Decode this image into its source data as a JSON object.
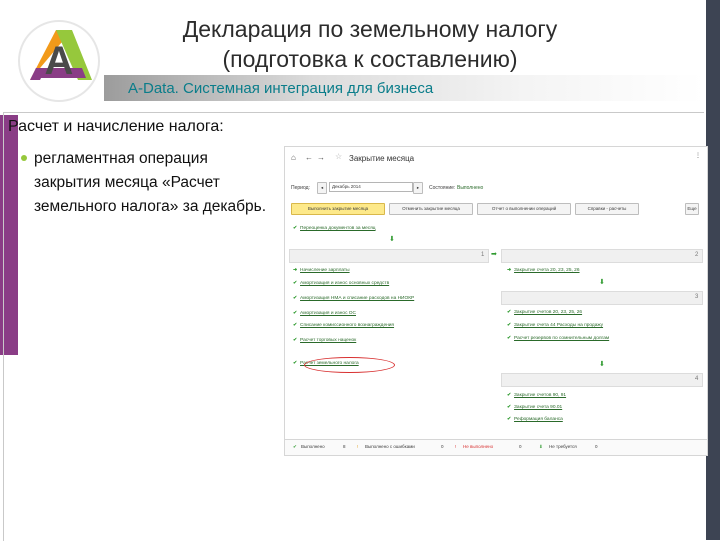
{
  "slide": {
    "title_line1": "Декларация по земельному налогу",
    "title_line2": "(подготовка к составлению)",
    "subtitle": "A-Data. Системная интеграция для бизнеса",
    "section_title": "Расчет и начисление налога:",
    "bullet_text": "регламентная операция закрытия месяца «Расчет земельного налога» за декабрь.",
    "logo_letter": "A",
    "colors": {
      "purple": "#8a3d86",
      "green": "#96c83c",
      "orange": "#f29a1a",
      "teal": "#0a7d8a",
      "dark": "#3d4453"
    }
  },
  "screenshot": {
    "window_title": "Закрытие месяца",
    "period_label": "Период:",
    "period_value": "Декабрь 2014",
    "status_label": "Состояние:",
    "status_value": "Выполнено",
    "toolbar": {
      "primary": "Выполнить закрытие месяца",
      "cancel": "Отменить закрытие месяца",
      "report": "Отчет о выполнении операций",
      "help": "Справки - расчеты",
      "more": "Еще"
    },
    "top_operation": "Переоценка документов за месяц",
    "stages": {
      "s1": "1",
      "s2": "2",
      "s3": "3",
      "s4": "4"
    },
    "left_ops": [
      "Начисление зарплаты",
      "Амортизация и износ основных средств",
      "Амортизация НМА и списание расходов на НИОКР",
      "Амортизация и износ ОС",
      "Списание комиссионного вознаграждения",
      "Расчет торговых наценок",
      "Расчет земельного налога"
    ],
    "right_top_op": "Закрытие счета 20, 23, 25, 26",
    "right_mid_ops": [
      "Закрытие счетов 20, 23, 25, 26",
      "Закрытие счета 44 Расходы на продажу",
      "Расчет резервов по сомнительным долгам"
    ],
    "right_bottom_ops": [
      "Закрытие счетов 90, 91",
      "Закрытие счета 90.01",
      "Реформация баланса"
    ],
    "footer": {
      "done": "Выполнено",
      "done_count": "8",
      "errors": "Выполнено с ошибками",
      "errors_count": "0",
      "not_done": "Не выполнено",
      "not_done_count": "0",
      "later": "Не требуется",
      "later_count": "0"
    }
  }
}
